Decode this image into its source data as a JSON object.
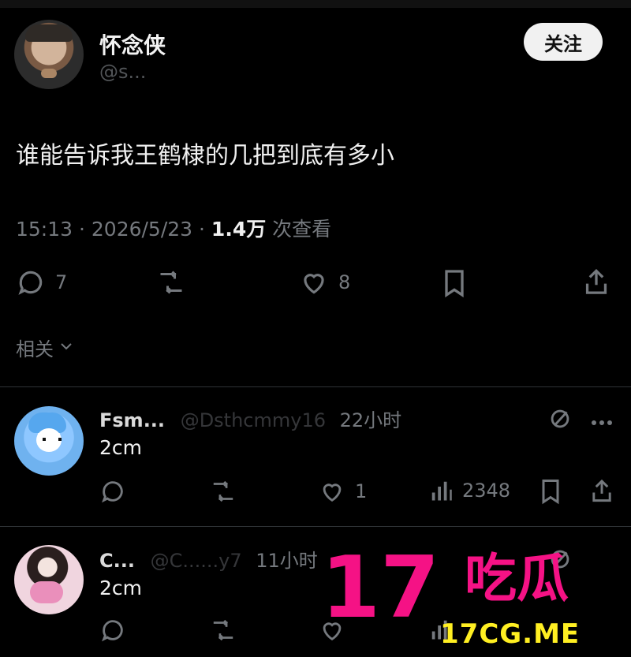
{
  "author": {
    "display_name": "怀念侠",
    "username": "@s..."
  },
  "follow_button": {
    "label": "关注"
  },
  "post": {
    "text": "谁能告诉我王鹤棣的几把到底有多小",
    "meta": {
      "time": "15:13 · 2026/5/23 · ",
      "views": "1.4万",
      "views_suffix": " 次查看"
    },
    "actions": {
      "comments": "7",
      "likes": "8"
    }
  },
  "related": {
    "label": "相关"
  },
  "replies": [
    {
      "name": "Fsm...",
      "handle": "@Dsthcmmy16",
      "time": "22小时",
      "text": "2cm",
      "likes": "1",
      "views": "2348"
    },
    {
      "name": "C...",
      "handle": "@C......y7",
      "time": "11小时",
      "text": "2cm"
    }
  ],
  "watermark": {
    "number": "17",
    "chinese": "吃瓜",
    "site": "17CG.ME"
  },
  "colors": {
    "background": "#000000",
    "text": "#f0f0f0",
    "muted": "#75797e",
    "follow_bg": "#f1f1f1",
    "watermark_pink": "#f51285",
    "watermark_yellow": "#ffef22"
  }
}
